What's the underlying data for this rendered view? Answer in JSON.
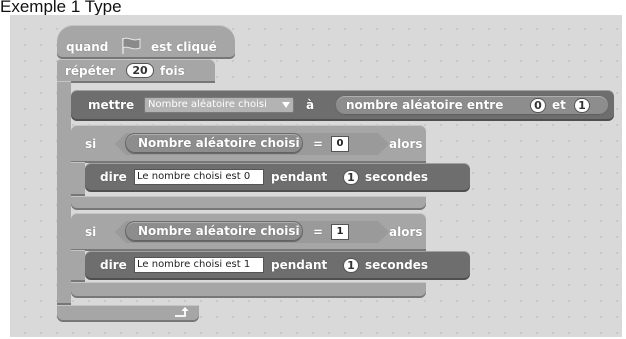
{
  "page_title": "Exemple 1 Type",
  "colors": {
    "canvas_bg": "#d9d9d9",
    "control_block": "#a6a6a6",
    "command_block": "#6e6e6e",
    "reporter_block": "#8d8d8d"
  },
  "script": {
    "hat": {
      "when_label": "quand",
      "icon": "green-flag-icon",
      "clicked_label": "est cliqué"
    },
    "repeat": {
      "label_before": "répéter",
      "count": "20",
      "label_after": "fois",
      "end_icon": "loop-arrow-icon"
    },
    "set_block": {
      "label": "mettre",
      "variable": "Nombre aléatoire choisi",
      "to_label": "à",
      "random": {
        "label_before": "nombre aléatoire entre",
        "from": "0",
        "and_label": "et",
        "to": "1"
      }
    },
    "if_blocks": [
      {
        "if_label": "si",
        "variable": "Nombre aléatoire choisi",
        "operator": "=",
        "value": "0",
        "then_label": "alors",
        "say": {
          "label": "dire",
          "text": "Le nombre choisi est 0",
          "for_label": "pendant",
          "seconds": "1",
          "seconds_label": "secondes"
        }
      },
      {
        "if_label": "si",
        "variable": "Nombre aléatoire choisi",
        "operator": "=",
        "value": "1",
        "then_label": "alors",
        "say": {
          "label": "dire",
          "text": "Le nombre choisi est 1",
          "for_label": "pendant",
          "seconds": "1",
          "seconds_label": "secondes"
        }
      }
    ]
  }
}
